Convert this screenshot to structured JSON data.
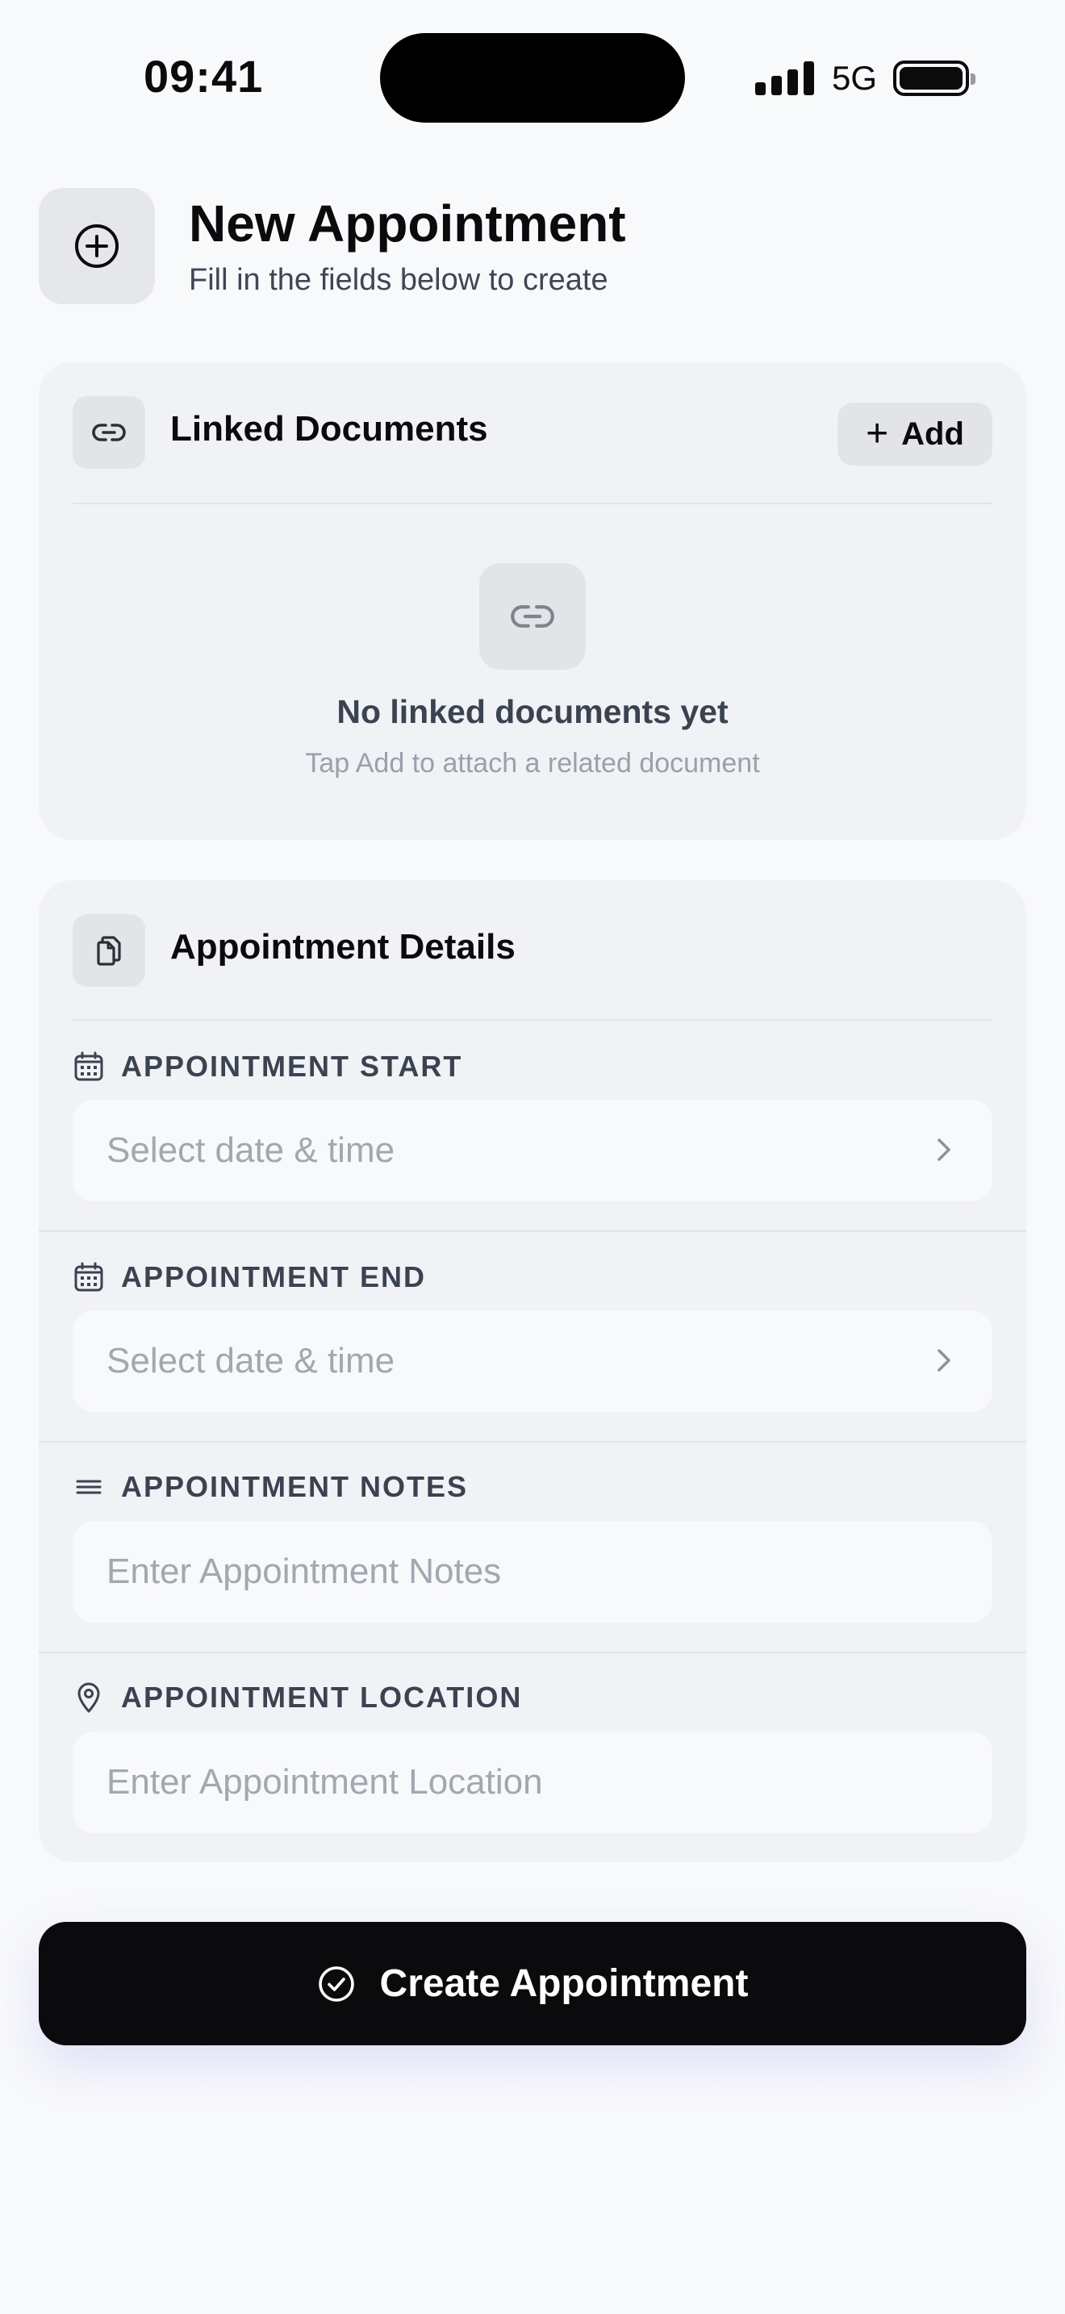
{
  "status_bar": {
    "time": "09:41",
    "network": "5G",
    "signal_bars": 4,
    "battery_level": 1.0
  },
  "header": {
    "title": "New Appointment",
    "subtitle": "Fill in the fields below to create",
    "icon": "plus-circle-icon"
  },
  "linked_documents": {
    "title": "Linked Documents",
    "icon": "link-icon",
    "add_label": "Add",
    "empty_title": "No linked documents yet",
    "empty_subtitle": "Tap Add to attach a related document"
  },
  "details": {
    "title": "Appointment Details",
    "icon": "documents-icon",
    "fields": [
      {
        "label": "APPOINTMENT START",
        "placeholder": "Select date & time",
        "icon": "calendar-icon",
        "type": "picker"
      },
      {
        "label": "APPOINTMENT END",
        "placeholder": "Select date & time",
        "icon": "calendar-icon",
        "type": "picker"
      },
      {
        "label": "APPOINTMENT NOTES",
        "placeholder": "Enter Appointment Notes",
        "icon": "lines-icon",
        "type": "text"
      },
      {
        "label": "APPOINTMENT LOCATION",
        "placeholder": "Enter Appointment Location",
        "icon": "map-pin-icon",
        "type": "text"
      }
    ]
  },
  "create_button": {
    "label": "Create Appointment",
    "icon": "check-circle-icon"
  },
  "colors": {
    "background": "#f8f9fb",
    "card": "#f0f2f6",
    "primary_button": "#0b0b0d",
    "placeholder": "#a2a7b0"
  }
}
